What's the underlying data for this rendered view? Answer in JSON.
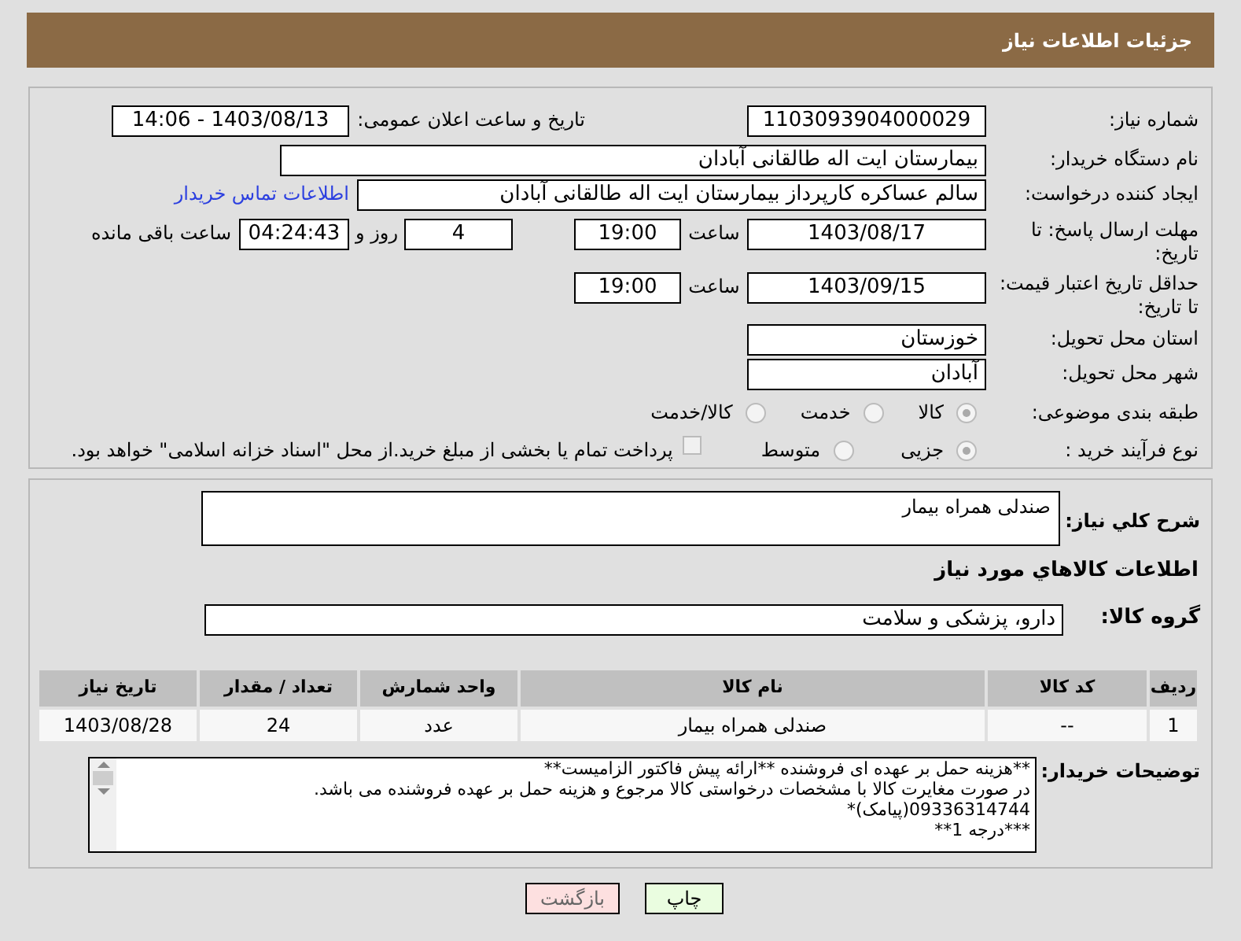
{
  "header": {
    "title": "جزئیات اطلاعات نیاز"
  },
  "details": {
    "need_number": {
      "label": "شماره نیاز:",
      "value": "1103093904000029"
    },
    "announce": {
      "label": "تاریخ و ساعت اعلان عمومی:",
      "value": "1403/08/13 - 14:06"
    },
    "buyer": {
      "label": "نام دستگاه خریدار:",
      "value": "بیمارستان ایت اله طالقانی آبادان"
    },
    "requester": {
      "label": "ایجاد کننده درخواست:",
      "value": "سالم عساکره کارپرداز بیمارستان ایت اله طالقانی آبادان",
      "link": "اطلاعات تماس خریدار"
    },
    "deadline": {
      "label": "مهلت ارسال پاسخ: تا تاریخ:",
      "date": "1403/08/17",
      "time_label": "ساعت",
      "time": "19:00",
      "days": "4",
      "days_label": "روز و",
      "remaining": "04:24:43",
      "remaining_label": "ساعت باقی مانده"
    },
    "validity": {
      "label": "حداقل تاریخ اعتبار قیمت: تا تاریخ:",
      "date": "1403/09/15",
      "time_label": "ساعت",
      "time": "19:00"
    },
    "province": {
      "label": "استان محل تحویل:",
      "value": "خوزستان"
    },
    "city": {
      "label": "شهر محل تحویل:",
      "value": "آبادان"
    },
    "category": {
      "label": "طبقه بندی موضوعی:",
      "options": [
        {
          "label": "کالا",
          "selected": true
        },
        {
          "label": "خدمت",
          "selected": false
        },
        {
          "label": "کالا/خدمت",
          "selected": false
        }
      ]
    },
    "purchase_type": {
      "label": "نوع فرآیند خرید :",
      "options": [
        {
          "label": "جزیی",
          "selected": true
        },
        {
          "label": "متوسط",
          "selected": false
        }
      ],
      "payment": {
        "checked": false,
        "text": "پرداخت تمام یا بخشی از مبلغ خرید.از محل \"اسناد خزانه اسلامی\" خواهد بود."
      }
    }
  },
  "needs": {
    "summary": {
      "label": "شرح کلي نیاز:",
      "value": "صندلی همراه بیمار"
    },
    "items_title": "اطلاعات کالاهاي مورد نیاز",
    "group": {
      "label": "گروه کالا:",
      "value": "دارو، پزشکی و سلامت"
    },
    "table": {
      "columns": [
        "ردیف",
        "کد کالا",
        "نام کالا",
        "واحد شمارش",
        "تعداد / مقدار",
        "تاریخ نیاز"
      ],
      "rows": [
        [
          "1",
          "--",
          "صندلی همراه بیمار",
          "عدد",
          "24",
          "1403/08/28"
        ]
      ]
    },
    "notes": {
      "label": "توضیحات خریدار:",
      "lines": [
        "**هزینه حمل بر عهده ای فروشنده **ارائه پیش فاکتور الزامیست**",
        "در صورت مغایرت کالا با مشخصات درخواستی کالا مرجوع و هزینه حمل بر عهده فروشنده می باشد.",
        "09336314744(پیامک)*",
        "***درجه 1**"
      ]
    }
  },
  "buttons": [
    {
      "label": "چاپ",
      "kind": "print"
    },
    {
      "label": "بازگشت",
      "kind": "back"
    }
  ]
}
